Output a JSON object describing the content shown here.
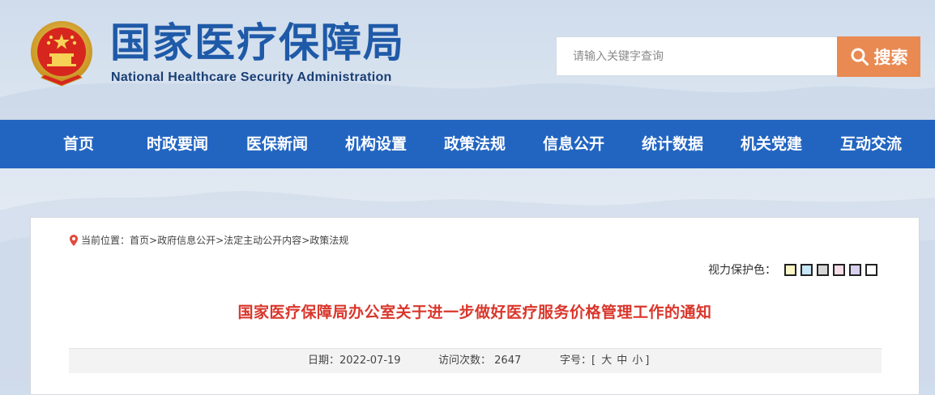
{
  "header": {
    "site_title_cn": "国家医疗保障局",
    "site_title_en": "National Healthcare Security Administration",
    "emblem_icon": "national-emblem-icon"
  },
  "search": {
    "placeholder": "请输入关键字查询",
    "button_label": "搜索",
    "button_icon": "search-icon",
    "button_color": "#e98a52"
  },
  "nav": {
    "color": "#2265c1",
    "items": [
      {
        "label": "首页"
      },
      {
        "label": "时政要闻"
      },
      {
        "label": "医保新闻"
      },
      {
        "label": "机构设置"
      },
      {
        "label": "政策法规"
      },
      {
        "label": "信息公开"
      },
      {
        "label": "统计数据"
      },
      {
        "label": "机关党建"
      },
      {
        "label": "互动交流"
      }
    ]
  },
  "breadcrumb": {
    "icon": "location-pin-icon",
    "prefix": "当前位置：",
    "items": [
      "首页",
      "政府信息公开",
      "法定主动公开内容",
      "政策法规"
    ],
    "separator": ">"
  },
  "vision": {
    "label": "视力保护色：",
    "swatches": [
      "#fbf7c8",
      "#c7e7f7",
      "#d6d6d6",
      "#f5dce6",
      "#d9d0ef",
      "#ffffff"
    ]
  },
  "article": {
    "title": "国家医疗保障局办公室关于进一步做好医疗服务价格管理工作的通知",
    "title_color": "#d9362b",
    "date_label": "日期：",
    "date": "2022-07-19",
    "views_label": "访问次数：",
    "views": "2647",
    "fontsize_label": "字号：",
    "fontsize_open": "[",
    "fontsize_large": "大",
    "fontsize_medium": "中",
    "fontsize_small": "小",
    "fontsize_close": "]"
  }
}
